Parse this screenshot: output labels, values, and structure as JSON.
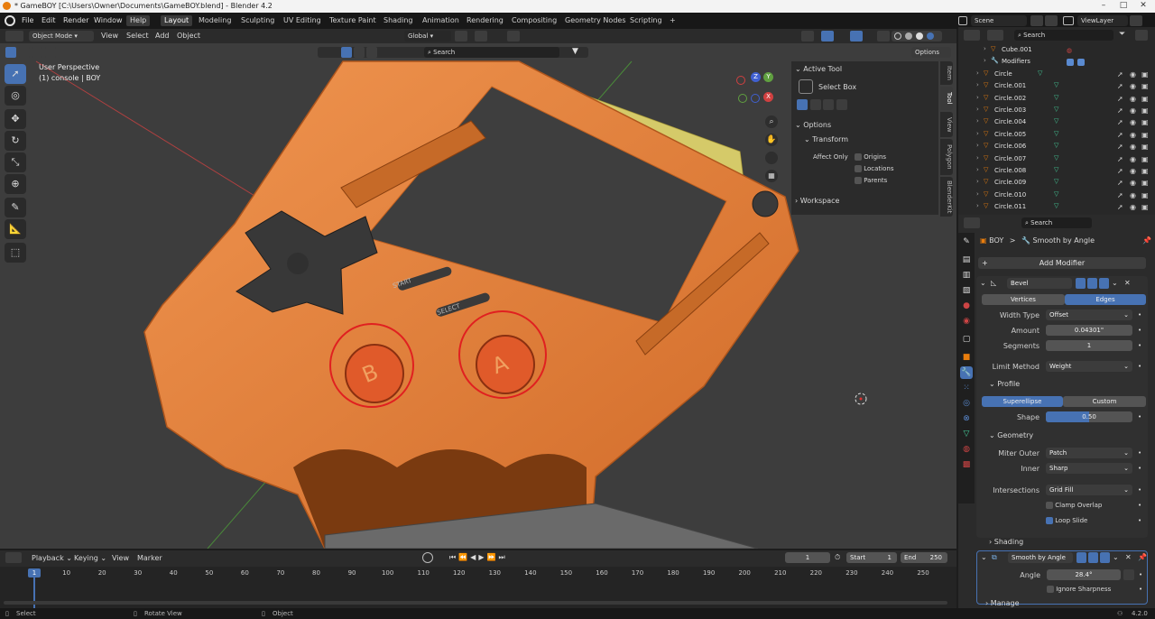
{
  "window": {
    "title": "* GameBOY [C:\\Users\\Owner\\Documents\\GameBOY.blend] - Blender 4.2"
  },
  "menubar": {
    "menus": [
      "File",
      "Edit",
      "Render",
      "Window",
      "Help"
    ],
    "workspaces": [
      "Layout",
      "Modeling",
      "Sculpting",
      "UV Editing",
      "Texture Paint",
      "Shading",
      "Animation",
      "Rendering",
      "Compositing",
      "Geometry Nodes",
      "Scripting"
    ],
    "active_workspace": "Layout",
    "add_tab": "+",
    "scene": "Scene",
    "view_layer": "ViewLayer"
  },
  "viewport_header": {
    "mode": "Object Mode",
    "menus": [
      "View",
      "Select",
      "Add",
      "Object"
    ],
    "orientation": "Global",
    "search_placeholder": "Search",
    "options": "Options"
  },
  "viewport": {
    "perspective": "User Perspective",
    "context": "(1) console | BOY",
    "gizmo_axes": {
      "x": "X",
      "y": "Y",
      "z": "Z"
    },
    "model_labels": {
      "start": "START",
      "select": "SELECT",
      "b": "B",
      "a": "A"
    }
  },
  "npanel": {
    "active_tool_header": "Active Tool",
    "tool_name": "Select Box",
    "options_header": "Options",
    "transform_header": "Transform",
    "affect_only": "Affect Only",
    "origins": "Origins",
    "locations": "Locations",
    "parents": "Parents",
    "workspace_header": "Workspace",
    "tabs": [
      "Item",
      "Tool",
      "View",
      "Polygon",
      "BlenderKit"
    ]
  },
  "outliner": {
    "search_placeholder": "Search",
    "rows": [
      {
        "name": "Cube.001",
        "indent": 2
      },
      {
        "name": "Modifiers",
        "indent": 2
      },
      {
        "name": "Circle",
        "indent": 1
      },
      {
        "name": "Circle.001",
        "indent": 1
      },
      {
        "name": "Circle.002",
        "indent": 1
      },
      {
        "name": "Circle.003",
        "indent": 1
      },
      {
        "name": "Circle.004",
        "indent": 1
      },
      {
        "name": "Circle.005",
        "indent": 1
      },
      {
        "name": "Circle.006",
        "indent": 1
      },
      {
        "name": "Circle.007",
        "indent": 1
      },
      {
        "name": "Circle.008",
        "indent": 1
      },
      {
        "name": "Circle.009",
        "indent": 1
      },
      {
        "name": "Circle.010",
        "indent": 1
      },
      {
        "name": "Circle.011",
        "indent": 1
      }
    ]
  },
  "properties": {
    "search_placeholder": "Search",
    "breadcrumb_object": "BOY",
    "breadcrumb_sep": ">",
    "breadcrumb_modifier": "Smooth by Angle",
    "add_modifier": "Add Modifier",
    "bevel": {
      "name": "Bevel",
      "tab_vertices": "Vertices",
      "tab_edges": "Edges",
      "width_type_label": "Width Type",
      "width_type": "Offset",
      "amount_label": "Amount",
      "amount": "0.04301\"",
      "segments_label": "Segments",
      "segments": "1",
      "limit_method_label": "Limit Method",
      "limit_method": "Weight",
      "profile_header": "Profile",
      "profile_superellipse": "Superellipse",
      "profile_custom": "Custom",
      "shape_label": "Shape",
      "shape": "0.50",
      "geometry_header": "Geometry",
      "miter_outer_label": "Miter Outer",
      "miter_outer": "Patch",
      "inner_label": "Inner",
      "inner": "Sharp",
      "intersections_label": "Intersections",
      "intersections": "Grid Fill",
      "clamp_overlap": "Clamp Overlap",
      "loop_slide": "Loop Slide",
      "shading_header": "Shading"
    },
    "smooth": {
      "name": "Smooth by Angle",
      "angle_label": "Angle",
      "angle": "28.4°",
      "ignore_sharpness": "Ignore Sharpness",
      "manage_header": "Manage"
    }
  },
  "timeline": {
    "menus": [
      "Playback",
      "Keying",
      "View",
      "Marker"
    ],
    "current_frame": "1",
    "start_label": "Start",
    "start": "1",
    "end_label": "End",
    "end": "250",
    "frame_marker": "1",
    "ticks": [
      "10",
      "20",
      "30",
      "40",
      "50",
      "60",
      "70",
      "80",
      "90",
      "100",
      "110",
      "120",
      "130",
      "140",
      "150",
      "160",
      "170",
      "180",
      "190",
      "200",
      "210",
      "220",
      "230",
      "240",
      "250"
    ]
  },
  "statusbar": {
    "select": "Select",
    "rotate": "Rotate View",
    "object": "Object",
    "version": "4.2.0"
  },
  "colors": {
    "accent": "#4772b3",
    "model_orange": "#e07b3a",
    "annotation_red": "#e02020"
  }
}
